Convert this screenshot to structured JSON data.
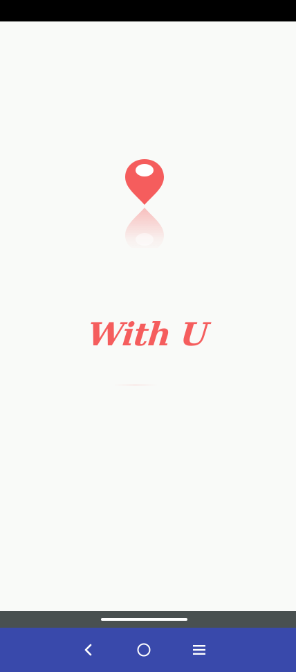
{
  "app": {
    "title": "With U"
  },
  "colors": {
    "brand": "#f55d5d",
    "background": "#f9faf8",
    "status_bar": "#000000",
    "gesture_bar": "#495050",
    "nav_bar": "#3949ab"
  },
  "icons": {
    "logo": "location-pin-icon",
    "nav_back": "chevron-left-icon",
    "nav_home": "circle-home-icon",
    "nav_menu": "hamburger-menu-icon"
  }
}
